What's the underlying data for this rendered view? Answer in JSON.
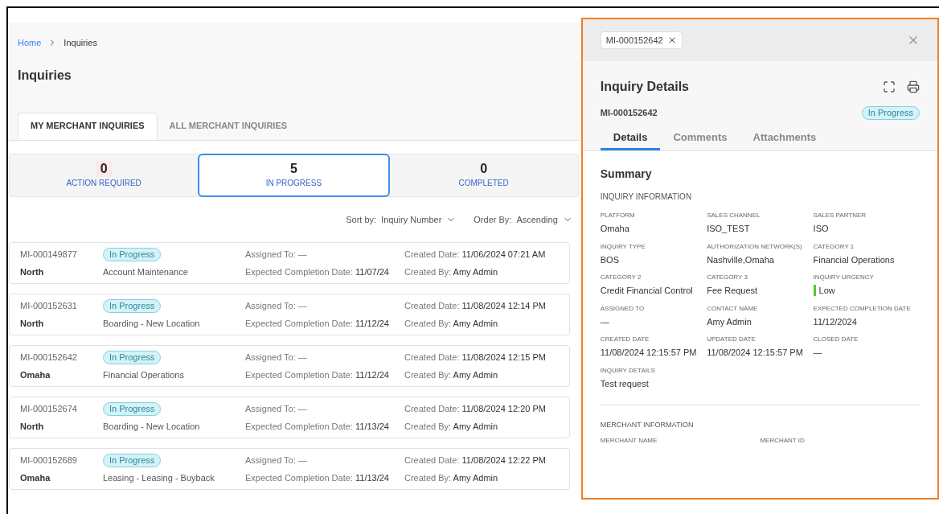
{
  "breadcrumb": [
    {
      "label": "Home",
      "link": true
    },
    {
      "label": "Inquiries",
      "link": false
    }
  ],
  "page_title": "Inquiries",
  "tabs": [
    {
      "label": "MY MERCHANT INQUIRIES",
      "selected": true
    },
    {
      "label": "ALL MERCHANT INQUIRIES",
      "selected": false
    }
  ],
  "stats": [
    {
      "count": "0",
      "label": "ACTION REQUIRED",
      "selected": false,
      "alert": true
    },
    {
      "count": "5",
      "label": "IN PROGRESS",
      "selected": true,
      "alert": false
    },
    {
      "count": "0",
      "label": "COMPLETED",
      "selected": false,
      "alert": false
    }
  ],
  "sort": [
    {
      "label": "Sort by:",
      "value": "Inquiry Number"
    },
    {
      "label": "Order By:",
      "value": "Ascending"
    }
  ],
  "inquiries": [
    {
      "id": "MI-000149877",
      "status": "In Progress",
      "region": "North",
      "category": "Account Maintenance",
      "assigned_label": "Assigned To:",
      "assigned": "—",
      "expected_label": "Expected Completion Date:",
      "expected": "11/07/24",
      "created_label": "Created Date:",
      "created": "11/06/2024 07:21 AM",
      "created_by_label": "Created By:",
      "created_by": "Amy Admin"
    },
    {
      "id": "MI-000152631",
      "status": "In Progress",
      "region": "North",
      "category": "Boarding - New Location",
      "assigned_label": "Assigned To:",
      "assigned": "—",
      "expected_label": "Expected Completion Date:",
      "expected": "11/12/24",
      "created_label": "Created Date:",
      "created": "11/08/2024 12:14 PM",
      "created_by_label": "Created By:",
      "created_by": "Amy Admin"
    },
    {
      "id": "MI-000152642",
      "status": "In Progress",
      "region": "Omaha",
      "category": "Financial Operations",
      "assigned_label": "Assigned To:",
      "assigned": "—",
      "expected_label": "Expected Completion Date:",
      "expected": "11/12/24",
      "created_label": "Created Date:",
      "created": "11/08/2024 12:15 PM",
      "created_by_label": "Created By:",
      "created_by": "Amy Admin"
    },
    {
      "id": "MI-000152674",
      "status": "In Progress",
      "region": "North",
      "category": "Boarding - New Location",
      "assigned_label": "Assigned To:",
      "assigned": "—",
      "expected_label": "Expected Completion Date:",
      "expected": "11/13/24",
      "created_label": "Created Date:",
      "created": "11/08/2024 12:20 PM",
      "created_by_label": "Created By:",
      "created_by": "Amy Admin"
    },
    {
      "id": "MI-000152689",
      "status": "In Progress",
      "region": "Omaha",
      "category": "Leasing - Leasing - Buyback",
      "assigned_label": "Assigned To:",
      "assigned": "—",
      "expected_label": "Expected Completion Date:",
      "expected": "11/13/24",
      "created_label": "Created Date:",
      "created": "11/08/2024 12:22 PM",
      "created_by_label": "Created By:",
      "created_by": "Amy Admin"
    }
  ],
  "panel": {
    "tag": "MI-000152642",
    "title": "Inquiry Details",
    "inquiry_id": "MI-000152642",
    "status": "In Progress",
    "tabs": [
      {
        "label": "Details",
        "selected": true
      },
      {
        "label": "Comments",
        "selected": false
      },
      {
        "label": "Attachments",
        "selected": false
      }
    ],
    "section_title": "Summary",
    "inquiry_heading": "INQUIRY INFORMATION",
    "fields": [
      {
        "label": "PLATFORM",
        "value": "Omaha"
      },
      {
        "label": "SALES CHANNEL",
        "value": "ISO_TEST"
      },
      {
        "label": "SALES PARTNER",
        "value": "ISO"
      },
      {
        "label": "INQUIRY TYPE",
        "value": "BOS"
      },
      {
        "label": "AUTHORIZATION NETWORK(S)",
        "value": "Nashville,Omaha"
      },
      {
        "label": "CATEGORY 1",
        "value": "Financial Operations"
      },
      {
        "label": "CATEGORY 2",
        "value": "Credit Financial Control"
      },
      {
        "label": "CATEGORY 3",
        "value": "Fee Request"
      },
      {
        "label": "INQUIRY URGENCY",
        "value": "Low",
        "color": "#5cc33a"
      },
      {
        "label": "ASSIGNED TO",
        "value": "—"
      },
      {
        "label": "CONTACT NAME",
        "value": "Amy Admin"
      },
      {
        "label": "EXPECTED COMPLETION DATE",
        "value": "11/12/2024"
      },
      {
        "label": "CREATED DATE",
        "value": "11/08/2024 12:15:57 PM"
      },
      {
        "label": "UPDATED DATE",
        "value": "11/08/2024 12:15:57 PM"
      },
      {
        "label": "CLOSED DATE",
        "value": "—"
      },
      {
        "label": "INQUIRY DETAILS",
        "value": "Test request"
      }
    ],
    "merchant_heading": "MERCHANT INFORMATION",
    "merchant_fields": [
      {
        "label": "MERCHANT NAME"
      },
      {
        "label": "MERCHANT ID"
      }
    ]
  }
}
